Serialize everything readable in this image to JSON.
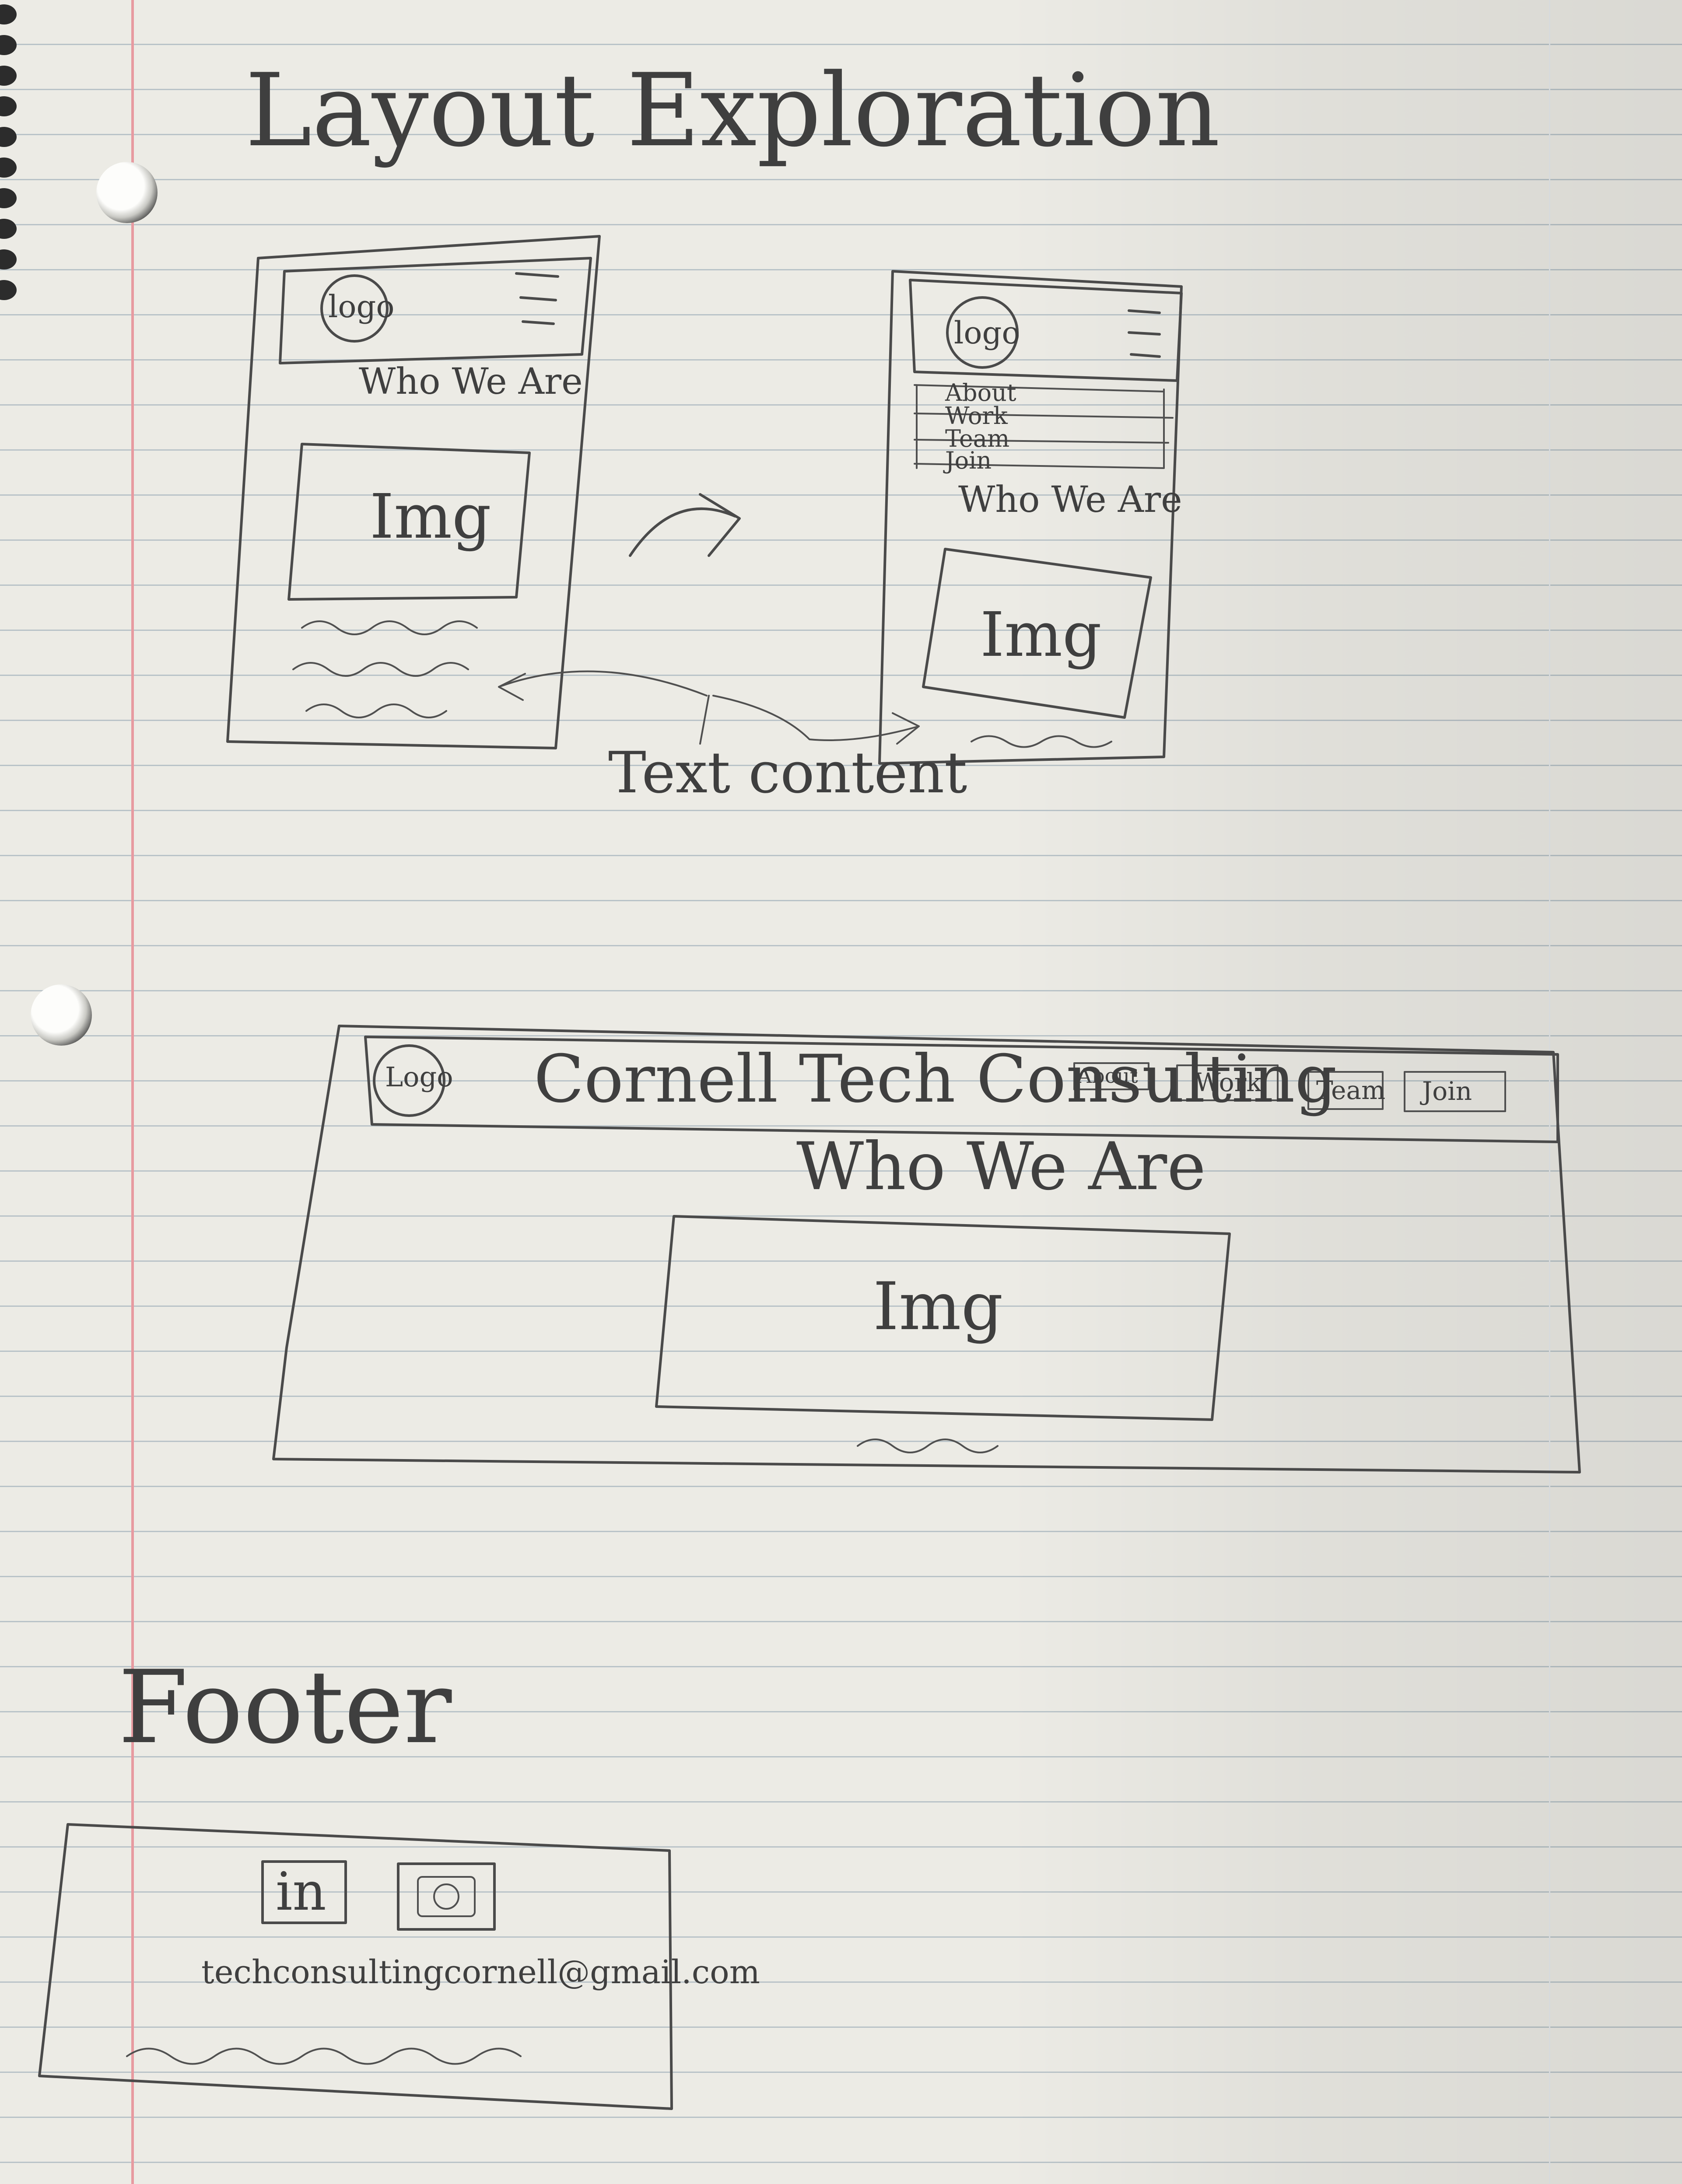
{
  "page": {
    "title": "Layout Exploration",
    "annotation": "Text content"
  },
  "mobile_closed": {
    "logo": "logo",
    "heading": "Who We Are",
    "image_label": "Img"
  },
  "mobile_open": {
    "logo": "logo",
    "menu_items": [
      "About",
      "Work",
      "Team",
      "Join"
    ],
    "heading": "Who We Are",
    "image_label": "Img"
  },
  "desktop": {
    "logo": "Logo",
    "site_title": "Cornell Tech Consulting",
    "nav": [
      "About",
      "Work",
      "Team",
      "Join"
    ],
    "heading": "Who We Are",
    "image_label": "Img"
  },
  "footer": {
    "heading": "Footer",
    "social": {
      "linkedin": "in",
      "instagram_icon": "instagram-icon"
    },
    "email": "techconsultingcornell@gmail.com"
  },
  "colors": {
    "paper": "#ecebe5",
    "rule": "#b9c3c8",
    "margin": "#e79aa0",
    "pencil": "#4a4a4a"
  }
}
